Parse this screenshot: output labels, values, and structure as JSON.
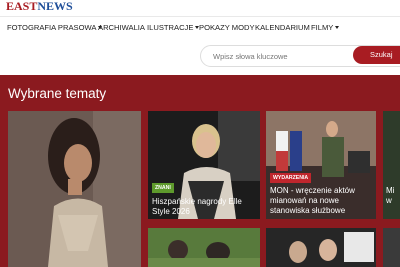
{
  "brand": {
    "part1": "EAST",
    "part2": "NEWS"
  },
  "nav": {
    "items": [
      {
        "label": "FOTOGRAFIA PRASOWA",
        "has_caret": true
      },
      {
        "label": "ARCHIWALIA",
        "has_caret": false
      },
      {
        "label": "ILUSTRACJE",
        "has_caret": true
      },
      {
        "label": "POKAZY MODY",
        "has_caret": false
      },
      {
        "label": "KALENDARIUM",
        "has_caret": false
      },
      {
        "label": "FILMY",
        "has_caret": true
      }
    ]
  },
  "search": {
    "placeholder": "Wpisz słowa kluczowe",
    "button_label": "Szukaj"
  },
  "main": {
    "section_title": "Wybrane tematy",
    "cards": [
      {
        "badge": "ZNANI",
        "caption": "Hiszpańskie nagrody Elle Style 2026"
      },
      {
        "badge": "WYDARZENIA",
        "caption": "MON - wręczenie aktów mianowań na nowe stanowiska służbowe"
      },
      {
        "caption": "Mi w"
      }
    ]
  },
  "colors": {
    "brand_red": "#a81c22",
    "brand_blue": "#1f4f9a",
    "badge_green": "#5e9a2c",
    "badge_red": "#c0262d"
  }
}
